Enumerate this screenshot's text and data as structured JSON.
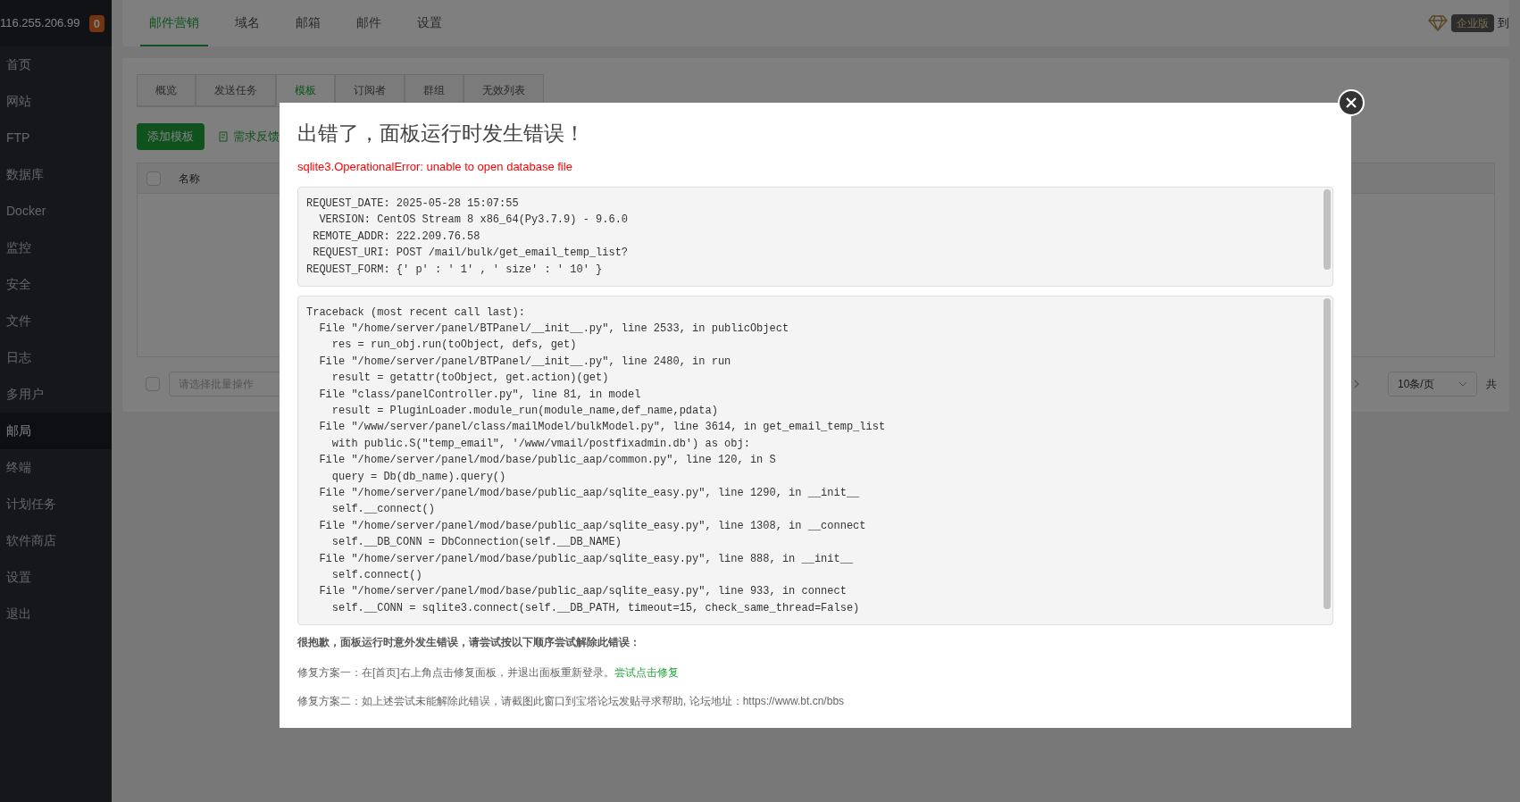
{
  "server": {
    "ip": "116.255.206.99",
    "badge": "0"
  },
  "sidebar": {
    "items": [
      {
        "label": "首页",
        "selected": false
      },
      {
        "label": "网站",
        "selected": false
      },
      {
        "label": "FTP",
        "selected": false
      },
      {
        "label": "数据库",
        "selected": false
      },
      {
        "label": "Docker",
        "selected": false
      },
      {
        "label": "监控",
        "selected": false
      },
      {
        "label": "安全",
        "selected": false
      },
      {
        "label": "文件",
        "selected": false
      },
      {
        "label": "日志",
        "selected": false
      },
      {
        "label": "多用户",
        "selected": false
      },
      {
        "label": "邮局",
        "selected": true
      },
      {
        "label": "终端",
        "selected": false
      },
      {
        "label": "计划任务",
        "selected": false
      },
      {
        "label": "软件商店",
        "selected": false
      },
      {
        "label": "设置",
        "selected": false
      },
      {
        "label": "退出",
        "selected": false
      }
    ]
  },
  "top_tabs": [
    {
      "label": "邮件营销",
      "selected": true
    },
    {
      "label": "域名",
      "selected": false
    },
    {
      "label": "邮箱",
      "selected": false
    },
    {
      "label": "邮件",
      "selected": false
    },
    {
      "label": "设置",
      "selected": false
    }
  ],
  "edition": {
    "badge": "企业版",
    "expiry": "到"
  },
  "sub_tabs": [
    {
      "label": "概览",
      "selected": false
    },
    {
      "label": "发送任务",
      "selected": false
    },
    {
      "label": "模板",
      "selected": true
    },
    {
      "label": "订阅者",
      "selected": false
    },
    {
      "label": "群组",
      "selected": false
    },
    {
      "label": "无效列表",
      "selected": false
    }
  ],
  "toolbar": {
    "add_button": "添加模板",
    "feedback_link": "需求反馈"
  },
  "table": {
    "columns": [
      "名称"
    ],
    "select_all_checked": false
  },
  "footer": {
    "batch_checked": false,
    "batch_placeholder": "请选择批量操作",
    "page_size": "10条/页",
    "total": "共"
  },
  "dialog": {
    "title": "出错了，面板运行时发生错误！",
    "error": "sqlite3.OperationalError: unable to open database file",
    "request_lines": [
      "REQUEST_DATE: 2025-05-28 15:07:55",
      "  VERSION: CentOS Stream 8 x86_64(Py3.7.9) - 9.6.0",
      " REMOTE_ADDR: 222.209.76.58",
      " REQUEST_URI: POST /mail/bulk/get_email_temp_list?",
      "REQUEST_FORM: {' p' : ' 1' , ' size' : ' 10' }"
    ],
    "traceback_lines": [
      "Traceback (most recent call last):",
      "  File \"/home/server/panel/BTPanel/__init__.py\", line 2533, in publicObject",
      "    res = run_obj.run(toObject, defs, get)",
      "  File \"/home/server/panel/BTPanel/__init__.py\", line 2480, in run",
      "    result = getattr(toObject, get.action)(get)",
      "  File \"class/panelController.py\", line 81, in model",
      "    result = PluginLoader.module_run(module_name,def_name,pdata)",
      "  File \"/www/server/panel/class/mailModel/bulkModel.py\", line 3614, in get_email_temp_list",
      "    with public.S(\"temp_email\", '/www/vmail/postfixadmin.db') as obj:",
      "  File \"/home/server/panel/mod/base/public_aap/common.py\", line 120, in S",
      "    query = Db(db_name).query()",
      "  File \"/home/server/panel/mod/base/public_aap/sqlite_easy.py\", line 1290, in __init__",
      "    self.__connect()",
      "  File \"/home/server/panel/mod/base/public_aap/sqlite_easy.py\", line 1308, in __connect",
      "    self.__DB_CONN = DbConnection(self.__DB_NAME)",
      "  File \"/home/server/panel/mod/base/public_aap/sqlite_easy.py\", line 888, in __init__",
      "    self.connect()",
      "  File \"/home/server/panel/mod/base/public_aap/sqlite_easy.py\", line 933, in connect",
      "    self.__CONN = sqlite3.connect(self.__DB_PATH, timeout=15, check_same_thread=False)"
    ],
    "apology": "很抱歉，面板运行时意外发生错误，请尝试按以下顺序尝试解除此错误：",
    "fixes": [
      {
        "text": "修复方案一：在[首页]右上角点击修复面板，并退出面板重新登录。",
        "link": "尝试点击修复"
      },
      {
        "text": "修复方案二：如上述尝试未能解除此错误，请截图此窗口到宝塔论坛发贴寻求帮助, 论坛地址：https://www.bt.cn/bbs"
      }
    ]
  }
}
